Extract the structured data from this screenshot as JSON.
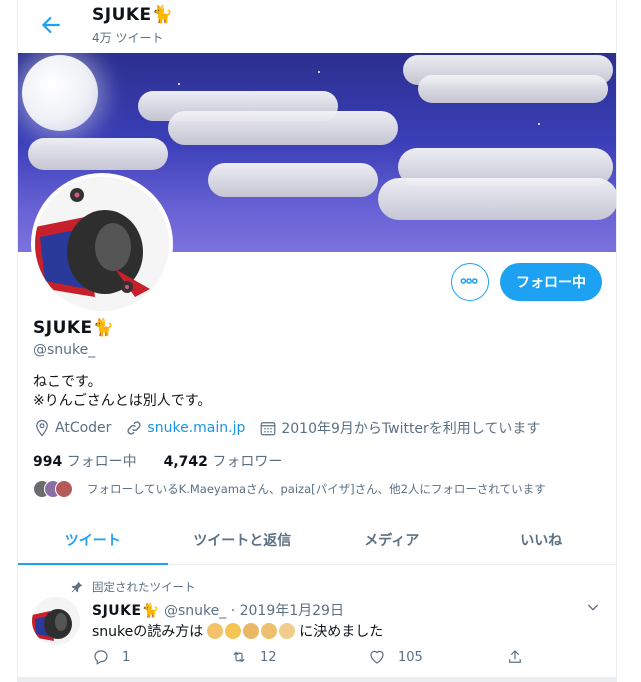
{
  "header": {
    "title": "SJUKE🐈",
    "tweet_count": "4万 ツイート"
  },
  "profile": {
    "name": "SJUKE🐈",
    "handle": "@snuke_",
    "bio_line1": "ねこです。",
    "bio_line2": "※りんごさんとは別人です。",
    "location": "AtCoder",
    "website": "snuke.main.jp",
    "joined": "2010年9月からTwitterを利用しています",
    "following_count": "994",
    "following_label": "フォロー中",
    "followers_count": "4,742",
    "followers_label": "フォロワー",
    "followed_by_text": "フォローしているK.Maeyamaさん、paiza[パイザ]さん、他2人にフォローされています",
    "follow_button": "フォロー中"
  },
  "tabs": [
    {
      "label": "ツイート",
      "active": true
    },
    {
      "label": "ツイートと返信",
      "active": false
    },
    {
      "label": "メディア",
      "active": false
    },
    {
      "label": "いいね",
      "active": false
    }
  ],
  "tweet": {
    "pinned_label": "固定されたツイート",
    "author": "SJUKE🐈",
    "handle": "@snuke_",
    "separator": "·",
    "date": "2019年1月29日",
    "text_before": "snukeの読み方は",
    "text_after": "に決めました",
    "replies": "1",
    "retweets": "12",
    "likes": "105"
  },
  "colors": {
    "accent": "#1da1f2",
    "link": "#1b95e0",
    "secondary_text": "#5b7083",
    "banner_sky": "#3b3fb8"
  },
  "icons": [
    "back-arrow-icon",
    "more-icon",
    "location-icon",
    "link-icon",
    "calendar-icon",
    "pin-icon",
    "chevron-down-icon",
    "reply-icon",
    "retweet-icon",
    "like-icon",
    "share-icon"
  ]
}
